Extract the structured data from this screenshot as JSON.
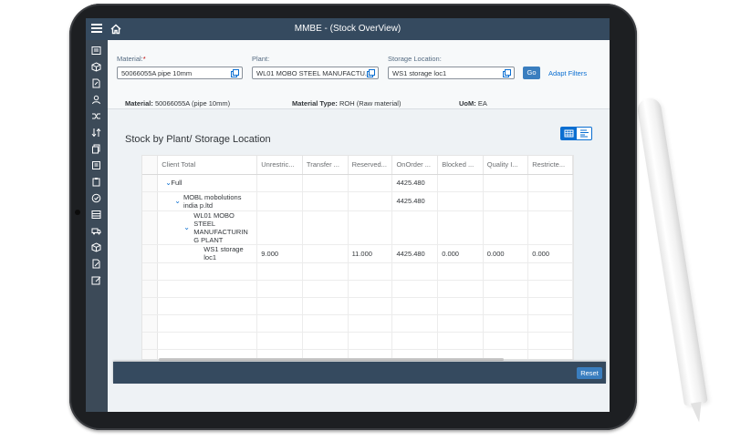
{
  "app": {
    "title": "MMBE - (Stock OverView)"
  },
  "filters": {
    "material": {
      "label": "Material:",
      "required_mark": "*",
      "value": "50066055A pipe 10mm"
    },
    "plant": {
      "label": "Plant:",
      "value": "WL01 MOBO STEEL MANUFACTU..."
    },
    "storage": {
      "label": "Storage Location:",
      "value": "WS1 storage loc1"
    },
    "go_label": "Go",
    "adapt_label": "Adapt Filters"
  },
  "header": {
    "material_label": "Material:",
    "material_value": "50066055A (pipe 10mm)",
    "type_label": "Material Type:",
    "type_value": "ROH (Raw material)",
    "uom_label": "UoM:",
    "uom_value": "EA"
  },
  "section_title": "Stock by Plant/ Storage Location",
  "table": {
    "columns": [
      "Client Total",
      "Unrestric...",
      "Transfer ...",
      "Reserved...",
      "OnOrder ...",
      "Blocked ...",
      "Quality I...",
      "Restricte..."
    ],
    "rows": [
      {
        "label": "Full",
        "unrestricted": "",
        "transfer": "",
        "reserved": "",
        "onorder": "4425.480",
        "blocked": "",
        "quality": "",
        "restricted": ""
      },
      {
        "label": "MOBL mobolutions india p.ltd",
        "unrestricted": "",
        "transfer": "",
        "reserved": "",
        "onorder": "4425.480",
        "blocked": "",
        "quality": "",
        "restricted": ""
      },
      {
        "label": "WL01 MOBO STEEL MANUFACTURIN G PLANT",
        "unrestricted": "",
        "transfer": "",
        "reserved": "",
        "onorder": "",
        "blocked": "",
        "quality": "",
        "restricted": ""
      },
      {
        "label": "WS1 storage loc1",
        "unrestricted": "9.000",
        "transfer": "",
        "reserved": "11.000",
        "onorder": "4425.480",
        "blocked": "0.000",
        "quality": "0.000",
        "restricted": "0.000"
      }
    ]
  },
  "footer": {
    "reset_label": "Reset"
  },
  "icons": {
    "shell": [
      "menu-icon",
      "home-icon"
    ],
    "nav": [
      "form-icon",
      "cube-icon",
      "document-edit-icon",
      "person-icon",
      "shuffle-icon",
      "transfer-icon",
      "copy-icon",
      "document-copy-icon",
      "clipboard-icon",
      "check-circle-icon",
      "list-icon",
      "truck-icon",
      "cube-icon",
      "edit-icon",
      "doc-edit-icon"
    ],
    "view_switch": [
      "table-view-icon",
      "chart-view-icon"
    ]
  },
  "colors": {
    "shell": "#354a5f",
    "accent": "#0a6ed1",
    "button": "#3a7ebf",
    "required": "#bb0000"
  }
}
